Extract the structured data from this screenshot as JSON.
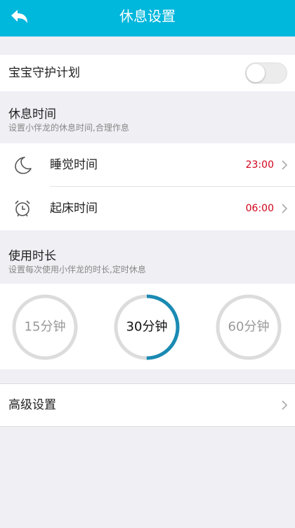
{
  "header": {
    "title": "休息设置",
    "back_icon": "back-arrow-icon",
    "background": "#00b7dc"
  },
  "guard": {
    "label": "宝宝守护计划",
    "enabled": false
  },
  "rest_time": {
    "title": "休息时间",
    "subtitle": "设置小伴龙的休息时间,合理作息",
    "rows": [
      {
        "label": "睡觉时间",
        "value": "23:00",
        "icon": "moon-icon"
      },
      {
        "label": "起床时间",
        "value": "06:00",
        "icon": "alarm-clock-icon"
      }
    ],
    "value_color": "#d0021b"
  },
  "usage": {
    "title": "使用时长",
    "subtitle": "设置每次使用小伴龙的时长,定时休息",
    "options": [
      {
        "label": "15分钟",
        "progress": 0,
        "selected": false
      },
      {
        "label": "30分钟",
        "progress": 0.5,
        "selected": true
      },
      {
        "label": "60分钟",
        "progress": 0,
        "selected": false
      }
    ],
    "accent_color": "#1a8ab3"
  },
  "advanced": {
    "label": "高级设置"
  }
}
